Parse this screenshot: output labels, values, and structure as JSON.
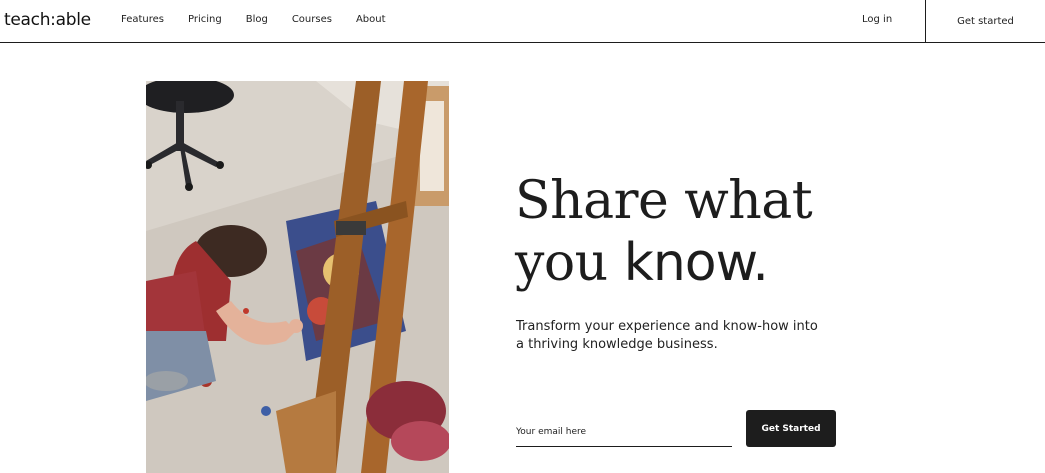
{
  "header": {
    "logo": "teach:able",
    "nav": [
      "Features",
      "Pricing",
      "Blog",
      "Courses",
      "About"
    ],
    "login_label": "Log in",
    "get_started_label": "Get started"
  },
  "hero": {
    "headline_part1": "Share what",
    "headline_part2": "you ",
    "headline_emphasis": "know.",
    "subtext": "Transform your experience and know-how into a thriving knowledge business.",
    "email_placeholder": "Your email here",
    "cta_label": "Get Started",
    "photo_alt": "Artist painting at an easel in a studio"
  },
  "colors": {
    "text": "#1d1d1d",
    "button_bg": "#1d1d1d",
    "button_text": "#ffffff",
    "background": "#ffffff"
  }
}
